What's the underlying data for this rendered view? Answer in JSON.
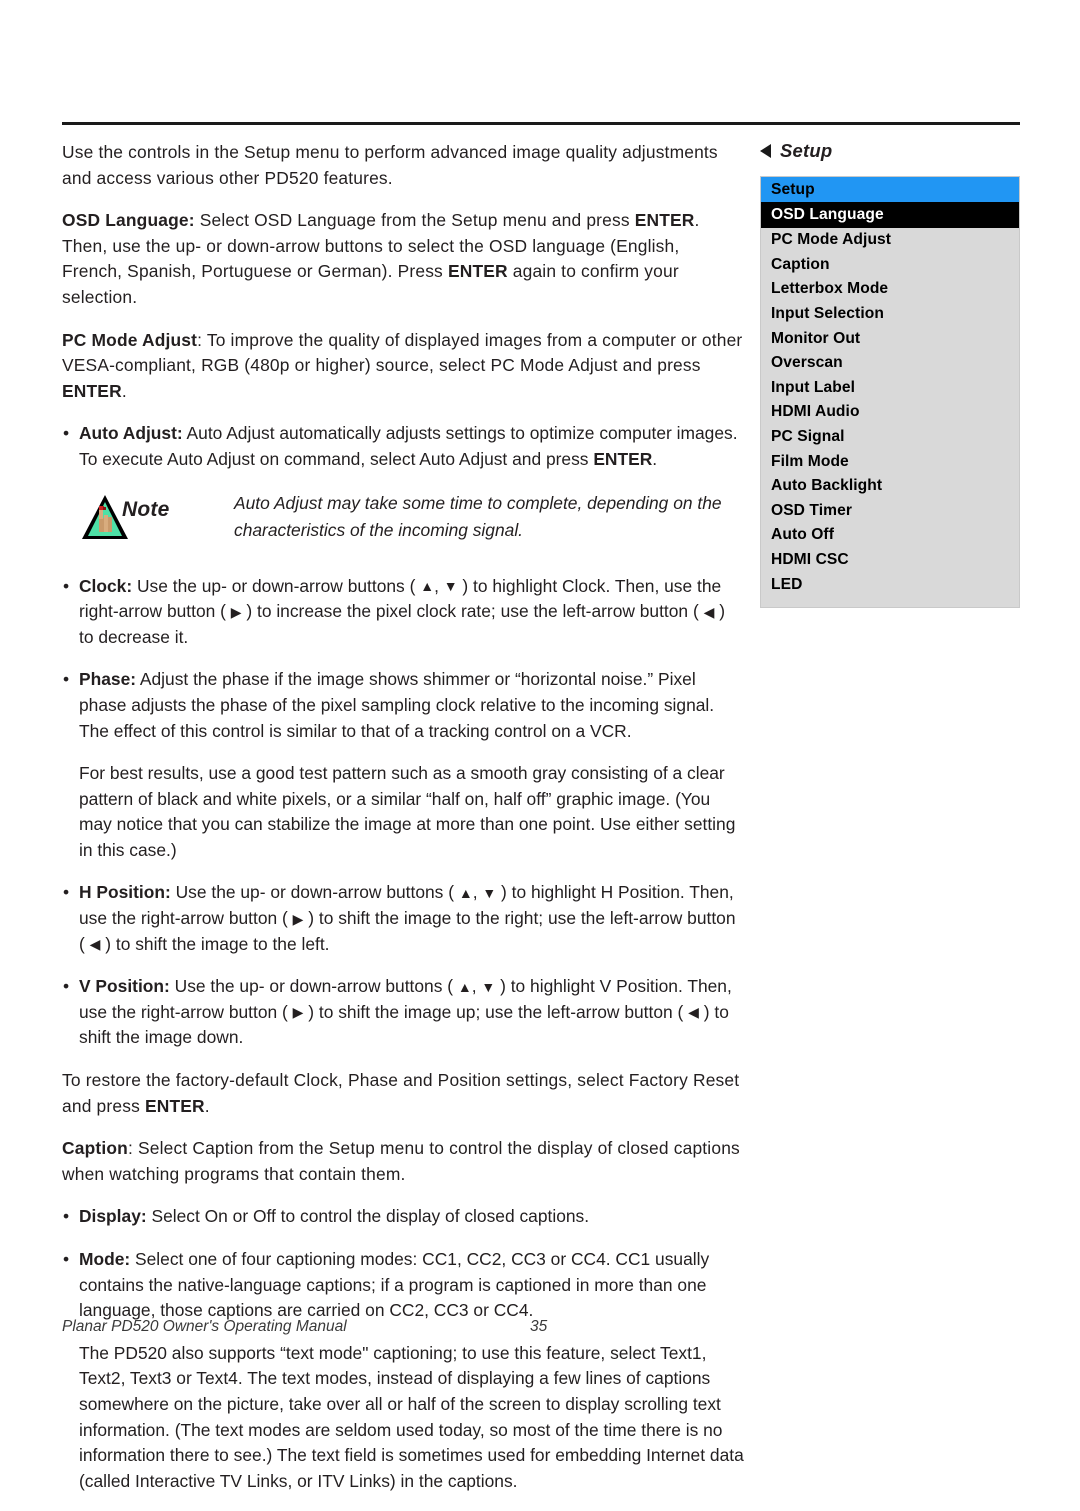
{
  "document": {
    "footer_title": "Planar PD520 Owner's Operating Manual",
    "page_number": "35"
  },
  "icons": {
    "note_label": "Note",
    "triangle_left": "◀",
    "triangle_right": "▶",
    "triangle_up": "▲",
    "triangle_down": "▼",
    "bullet": "•"
  },
  "colors": {
    "menu_header_blue": "#2196f3",
    "menu_panel_gray": "#d9d9d9",
    "menu_selected_black": "#000000",
    "note_triangle_fill": "#4ee0a6",
    "text": "#231f20"
  },
  "body": {
    "intro": {
      "line": "Use the controls in the Setup menu to perform advanced image quality adjustments and access various other PD520 features."
    },
    "osd_language": {
      "term": "OSD Language:",
      "t1": " Select OSD Language from the Setup menu and press ",
      "b1": "ENTER",
      "t2": ". Then, use the up- or down-arrow buttons to select the OSD language (English, French, Spanish, Portuguese or German). Press ",
      "b2": "ENTER",
      "t3": " again to confirm your selection."
    },
    "pc_mode_adjust": {
      "term": "PC Mode Adjust",
      "t1": ": To improve the quality of displayed images from a computer or other VESA-compliant, RGB (480p or higher) source, select PC Mode Adjust and press ",
      "b1": "ENTER",
      "t2": "."
    },
    "auto_adjust": {
      "term": "Auto Adjust:",
      "t1": " Auto Adjust automatically adjusts settings to optimize computer images. To execute Auto Adjust on command, select Auto Adjust and press ",
      "b1": "ENTER",
      "t2": "."
    },
    "note": {
      "text": "Auto Adjust may take some time to complete, depending on the characteristics of the incoming signal."
    },
    "clock": {
      "term": "Clock:",
      "t1": " Use the up- or down-arrow buttons ( ",
      "t2": ", ",
      "t3": " ) to highlight Clock. Then, use the right-arrow button ( ",
      "t4": " ) to increase the pixel clock rate; use the left-arrow button ( ",
      "t5": " ) to decrease it."
    },
    "phase": {
      "term": "Phase:",
      "t1": " Adjust the phase if the image shows shimmer or “horizontal noise.” Pixel phase adjusts the phase of the pixel sampling clock relative to the incoming signal. The effect of this control is similar to that of a tracking control on a VCR."
    },
    "test_pattern": {
      "text": "For best results, use a good test pattern such as a smooth gray consisting of a clear pattern of black and white pixels, or a similar “half on, half off” graphic image. (You may notice that you can stabilize the image at more than one point. Use either setting in this case.)"
    },
    "h_position": {
      "term": "H Position:",
      "t1": " Use the up- or down-arrow buttons ( ",
      "t2": ", ",
      "t3": " ) to highlight H Position. Then, use the right-arrow button ( ",
      "t4": " ) to shift the image to the right; use the left-arrow button ( ",
      "t5": " ) to shift the image to the left."
    },
    "v_position": {
      "term": "V Position:",
      "t1": " Use the up- or down-arrow buttons ( ",
      "t2": ", ",
      "t3": " ) to highlight V Position. Then, use the right-arrow button ( ",
      "t4": " ) to shift the image up; use the left-arrow button ( ",
      "t5": " ) to shift the image down."
    },
    "factory_reset": {
      "t1": "To restore the factory-default Clock, Phase and Position settings, select Factory Reset and press ",
      "b1": "ENTER",
      "t2": "."
    },
    "caption": {
      "term": "Caption",
      "t1": ": Select Caption from the Setup menu to control the display of closed captions when watching programs that contain them."
    },
    "display": {
      "term": "Display:",
      "t1": " Select On or Off to control the display of closed captions."
    },
    "mode": {
      "term": "Mode:",
      "t1": " Select one of four captioning modes: CC1, CC2, CC3 or CC4. CC1 usually contains the native-language captions; if a program is captioned in more than one language, those captions are carried on CC2, CC3 or CC4."
    },
    "text_mode": {
      "text": "The PD520 also supports “text mode\" captioning; to use this feature, select Text1, Text2, Text3 or Text4. The text modes, instead of displaying a few lines of captions somewhere on the picture, take over all or half of the screen to display scrolling text information. (The text modes are seldom used today, so most of the time there is no information there to see.) The text field is sometimes used for embedding Internet data (called Interactive TV Links, or ITV Links) in the captions."
    }
  },
  "osd_menu": {
    "title": "Setup",
    "header": "Setup",
    "selected": "OSD Language",
    "items": [
      {
        "label": "PC Mode Adjust"
      },
      {
        "label": "Caption"
      },
      {
        "label": "Letterbox Mode"
      },
      {
        "label": "Input Selection"
      },
      {
        "label": "Monitor Out"
      },
      {
        "label": "Overscan"
      },
      {
        "label": "Input Label"
      },
      {
        "label": "HDMI Audio"
      },
      {
        "label": "PC Signal"
      },
      {
        "label": "Film Mode"
      },
      {
        "label": "Auto Backlight"
      },
      {
        "label": "OSD Timer"
      },
      {
        "label": "Auto Off"
      },
      {
        "label": "HDMI CSC"
      },
      {
        "label": "LED"
      }
    ]
  }
}
